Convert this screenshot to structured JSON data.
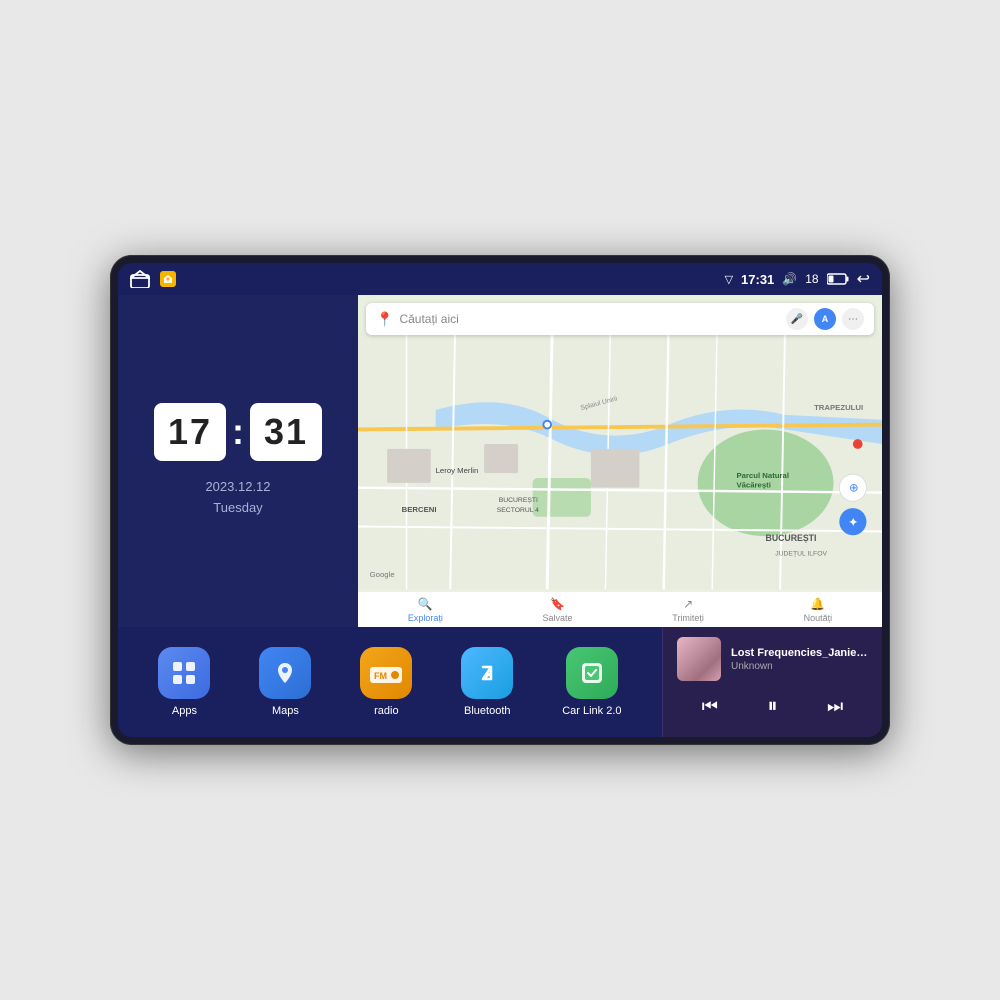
{
  "device": {
    "status_bar": {
      "signal_icon": "▽",
      "time": "17:31",
      "volume_icon": "🔊",
      "battery_level": "18",
      "battery_icon": "▭",
      "back_icon": "↩"
    },
    "clock": {
      "hours": "17",
      "minutes": "31",
      "date": "2023.12.12",
      "day": "Tuesday"
    },
    "map": {
      "search_placeholder": "Căutați aici",
      "nav_items": [
        {
          "label": "Explorați",
          "active": true
        },
        {
          "label": "Salvate",
          "active": false
        },
        {
          "label": "Trimiteți",
          "active": false
        },
        {
          "label": "Noutăți",
          "active": false
        }
      ],
      "labels": {
        "parcul": "Parcul Natural Văcărești",
        "leroy": "Leroy Merlin",
        "berceni": "BERCENI",
        "bucuresti": "BUCUREȘTI",
        "judet": "JUDEȚUL ILFOV",
        "trapezului": "TRAPEZULUI",
        "bucuresti_sector": "BUCUREȘTI SECTORUL 4",
        "splaiulunii": "Splaiul Unirii"
      }
    },
    "app_icons": [
      {
        "id": "apps",
        "label": "Apps",
        "icon": "⊞",
        "color_class": "apps-icon"
      },
      {
        "id": "maps",
        "label": "Maps",
        "icon": "📍",
        "color_class": "maps-icon"
      },
      {
        "id": "radio",
        "label": "radio",
        "icon": "FM",
        "color_class": "radio-icon"
      },
      {
        "id": "bluetooth",
        "label": "Bluetooth",
        "icon": "⚡",
        "color_class": "bt-icon"
      },
      {
        "id": "carlink",
        "label": "Car Link 2.0",
        "icon": "⊡",
        "color_class": "carlink-icon"
      }
    ],
    "music_player": {
      "title": "Lost Frequencies_Janieck Devy-...",
      "artist": "Unknown",
      "prev_icon": "⏮",
      "play_icon": "⏸",
      "next_icon": "⏭"
    }
  }
}
